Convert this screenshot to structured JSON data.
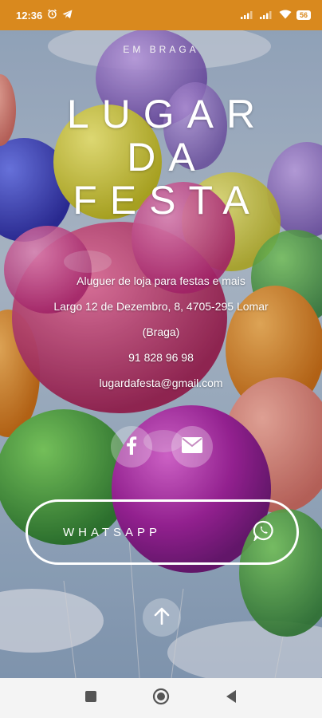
{
  "status_bar": {
    "time": "12:36",
    "battery": "56",
    "icons": [
      "alarm-icon",
      "telegram-icon",
      "signal-icon",
      "signal-icon",
      "wifi-icon",
      "battery-icon"
    ],
    "background_color": "#d9891e"
  },
  "hero": {
    "subtitle": "EM BRAGA",
    "title_lines": [
      "LUGAR",
      "DA",
      "FESTA"
    ],
    "description": "Aluguer de loja para festas e mais",
    "address_line1": "Largo 12 de Dezembro, 8, 4705-295 Lomar",
    "address_line2": "(Braga)",
    "phone": "91 828 96 98",
    "email": "lugardafesta@gmail.com"
  },
  "social": {
    "facebook_icon": "facebook-icon",
    "email_icon": "envelope-icon"
  },
  "whatsapp": {
    "label": "WHATSAPP",
    "icon": "whatsapp-icon"
  },
  "scroll_top": {
    "icon": "arrow-up-icon"
  },
  "nav_bar": {
    "icons": [
      "recents-square-icon",
      "home-circle-icon",
      "back-triangle-icon"
    ]
  }
}
